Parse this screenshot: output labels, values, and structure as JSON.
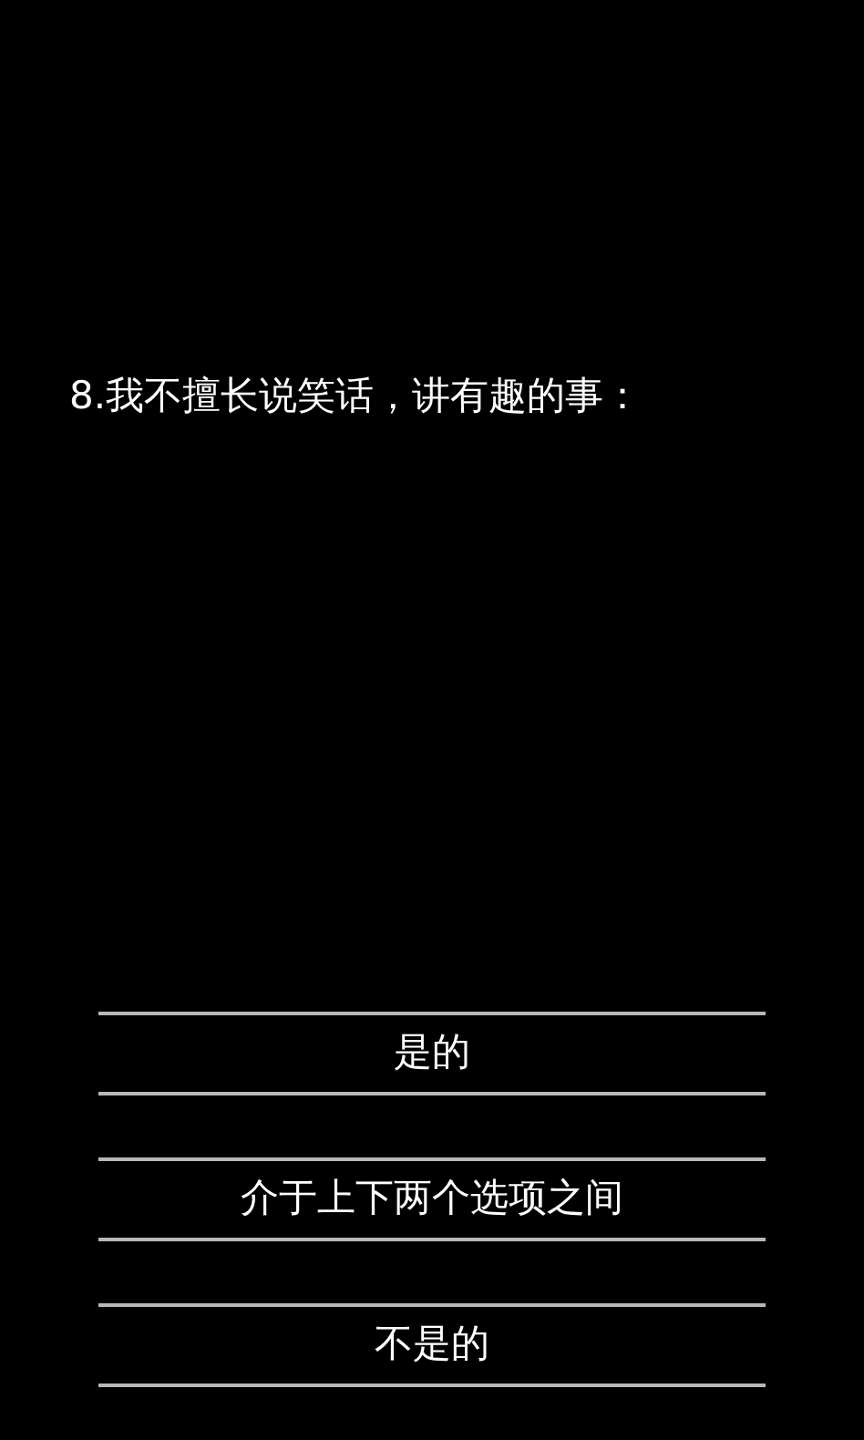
{
  "question": "8.我不擅长说笑话，讲有趣的事：",
  "options": [
    {
      "label": "是的"
    },
    {
      "label": "介于上下两个选项之间"
    },
    {
      "label": "不是的"
    }
  ]
}
